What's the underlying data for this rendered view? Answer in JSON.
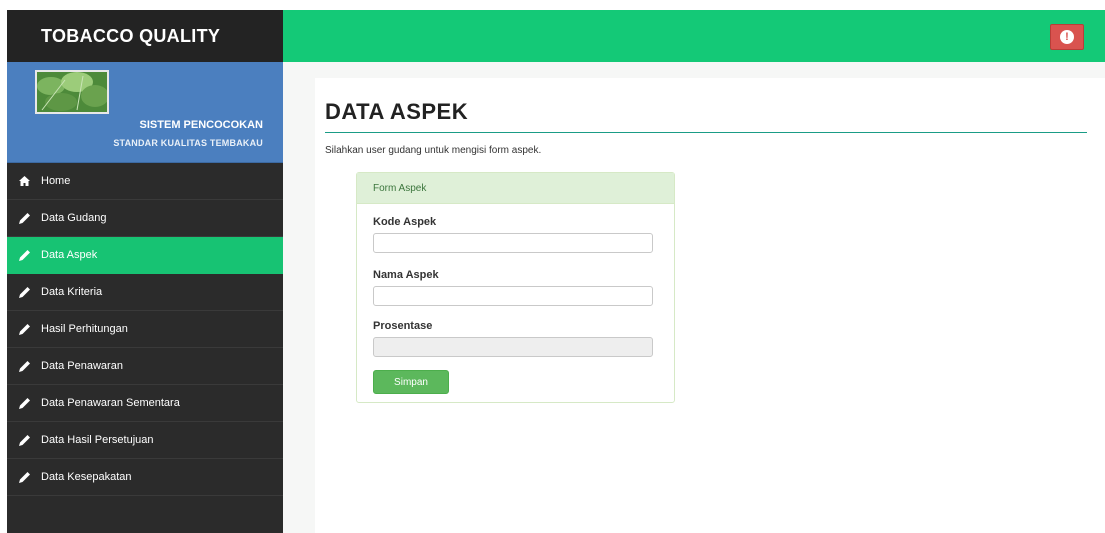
{
  "sidebar": {
    "brand": "TOBACCO QUALITY",
    "profile": {
      "line1": "SISTEM PENCOCOKAN",
      "line2": "STANDAR KUALITAS TEMBAKAU"
    },
    "items": [
      {
        "label": "Home",
        "icon": "home-icon"
      },
      {
        "label": "Data Gudang",
        "icon": "pencil-icon"
      },
      {
        "label": "Data Aspek",
        "icon": "pencil-icon",
        "active": true
      },
      {
        "label": "Data Kriteria",
        "icon": "pencil-icon"
      },
      {
        "label": "Hasil Perhitungan",
        "icon": "pencil-icon"
      },
      {
        "label": "Data Penawaran",
        "icon": "pencil-icon"
      },
      {
        "label": "Data Penawaran Sementara",
        "icon": "pencil-icon"
      },
      {
        "label": "Data Hasil Persetujuan",
        "icon": "pencil-icon"
      },
      {
        "label": "Data Kesepakatan",
        "icon": "pencil-icon"
      }
    ]
  },
  "header": {
    "alert_icon": "exclamation-circle-icon",
    "alert_glyph": "!"
  },
  "main": {
    "title": "DATA ASPEK",
    "subtitle": "Silahkan user gudang untuk mengisi form aspek.",
    "form": {
      "heading": "Form Aspek",
      "fields": [
        {
          "label": "Kode Aspek",
          "value": ""
        },
        {
          "label": "Nama Aspek",
          "value": ""
        },
        {
          "label": "Prosentase",
          "value": ""
        }
      ],
      "submit_label": "Simpan"
    }
  },
  "colors": {
    "header": "#14c977",
    "sidebar": "#2b2b2b",
    "active_item": "#17c373",
    "profile": "#4b7fbf",
    "alert": "#d9534f",
    "button": "#5cb85c"
  }
}
